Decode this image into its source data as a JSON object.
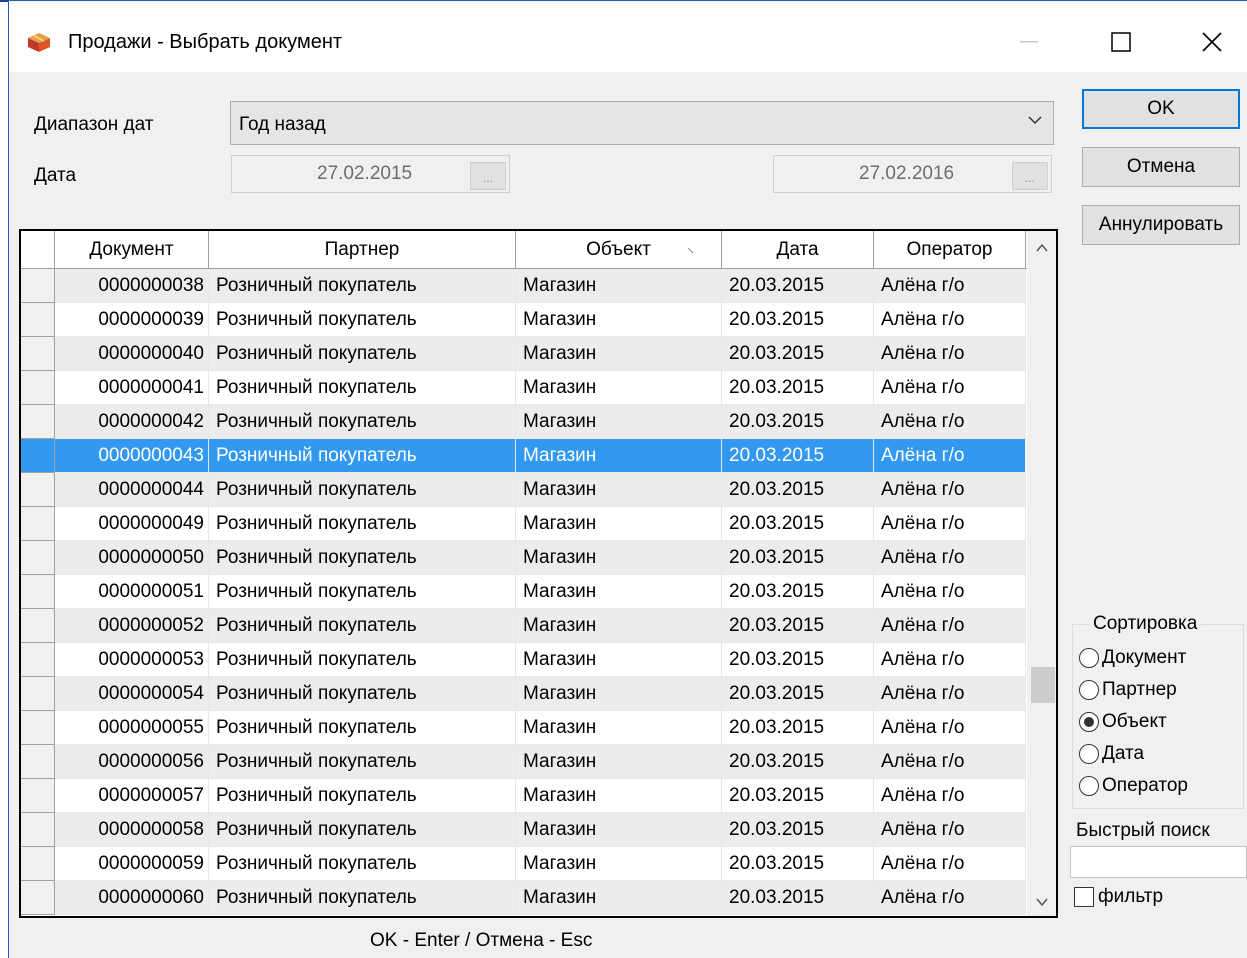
{
  "window": {
    "title": "Продажи - Выбрать документ"
  },
  "filters": {
    "range_label": "Диапазон дат",
    "range_value": "Год назад",
    "date_label": "Дата",
    "date_from": "27.02.2015",
    "date_to": "27.02.2016",
    "picker_label": "..."
  },
  "buttons": {
    "ok": "OK",
    "cancel": "Отмена",
    "annul": "Аннулировать"
  },
  "table": {
    "columns": [
      "Документ",
      "Партнер",
      "Объект",
      "Дата",
      "Оператор"
    ],
    "sorted_column": "Объект",
    "selected_document": "0000000043",
    "rows": [
      [
        "0000000038",
        "Розничный покупатель",
        "Магазин",
        "20.03.2015",
        "Алёна г/о"
      ],
      [
        "0000000039",
        "Розничный покупатель",
        "Магазин",
        "20.03.2015",
        "Алёна г/о"
      ],
      [
        "0000000040",
        "Розничный покупатель",
        "Магазин",
        "20.03.2015",
        "Алёна г/о"
      ],
      [
        "0000000041",
        "Розничный покупатель",
        "Магазин",
        "20.03.2015",
        "Алёна г/о"
      ],
      [
        "0000000042",
        "Розничный покупатель",
        "Магазин",
        "20.03.2015",
        "Алёна г/о"
      ],
      [
        "0000000043",
        "Розничный покупатель",
        "Магазин",
        "20.03.2015",
        "Алёна г/о"
      ],
      [
        "0000000044",
        "Розничный покупатель",
        "Магазин",
        "20.03.2015",
        "Алёна г/о"
      ],
      [
        "0000000049",
        "Розничный покупатель",
        "Магазин",
        "20.03.2015",
        "Алёна г/о"
      ],
      [
        "0000000050",
        "Розничный покупатель",
        "Магазин",
        "20.03.2015",
        "Алёна г/о"
      ],
      [
        "0000000051",
        "Розничный покупатель",
        "Магазин",
        "20.03.2015",
        "Алёна г/о"
      ],
      [
        "0000000052",
        "Розничный покупатель",
        "Магазин",
        "20.03.2015",
        "Алёна г/о"
      ],
      [
        "0000000053",
        "Розничный покупатель",
        "Магазин",
        "20.03.2015",
        "Алёна г/о"
      ],
      [
        "0000000054",
        "Розничный покупатель",
        "Магазин",
        "20.03.2015",
        "Алёна г/о"
      ],
      [
        "0000000055",
        "Розничный покупатель",
        "Магазин",
        "20.03.2015",
        "Алёна г/о"
      ],
      [
        "0000000056",
        "Розничный покупатель",
        "Магазин",
        "20.03.2015",
        "Алёна г/о"
      ],
      [
        "0000000057",
        "Розничный покупатель",
        "Магазин",
        "20.03.2015",
        "Алёна г/о"
      ],
      [
        "0000000058",
        "Розничный покупатель",
        "Магазин",
        "20.03.2015",
        "Алёна г/о"
      ],
      [
        "0000000059",
        "Розничный покупатель",
        "Магазин",
        "20.03.2015",
        "Алёна г/о"
      ],
      [
        "0000000060",
        "Розничный покупатель",
        "Магазин",
        "20.03.2015",
        "Алёна г/о"
      ]
    ]
  },
  "sorting": {
    "title": "Сортировка",
    "options": [
      "Документ",
      "Партнер",
      "Объект",
      "Дата",
      "Оператор"
    ],
    "selected": "Объект"
  },
  "quick_search": {
    "label": "Быстрый поиск",
    "value": "",
    "filter_label": "фильтр",
    "filter_checked": false
  },
  "status_bar": "OK - Enter / Отмена - Esc",
  "colors": {
    "selection": "#3398f0",
    "ok_border": "#0078d7",
    "title_accent": "#1e3fa8"
  },
  "icons": {
    "app": "box-icon",
    "minimize": "minimize-icon",
    "maximize": "maximize-icon",
    "close": "close-icon"
  }
}
